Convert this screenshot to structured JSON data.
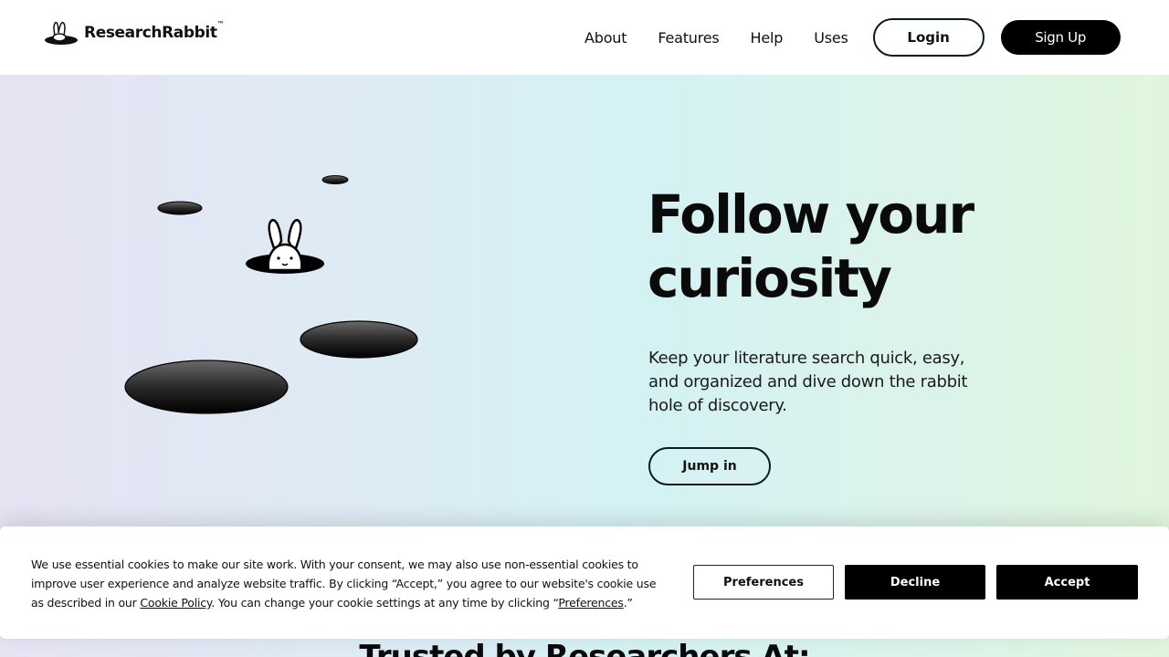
{
  "header": {
    "brand": "ResearchRabbit",
    "brand_tm": "™",
    "nav": [
      "About",
      "Features",
      "Help",
      "Uses"
    ],
    "login_label": "Login",
    "signup_label": "Sign Up"
  },
  "hero": {
    "headline_line1": "Follow your",
    "headline_line2": "curiosity",
    "subtext": "Keep your literature search quick, easy, and organized and dive down the rabbit hole of discovery.",
    "cta_label": "Jump in"
  },
  "trusted_heading": "Trusted by Researchers At:",
  "cookie": {
    "text_part1": "We use essential cookies to make our site work. With your consent, we may also use non-essential cookies to improve user experience and analyze website traffic. By clicking “Accept,” you agree to our website's cookie use as described in our ",
    "cookie_policy_link": "Cookie Policy",
    "text_part2": ". You can change your cookie settings at any time by clicking “",
    "preferences_link": "Preferences",
    "text_part3": ".”",
    "preferences_button": "Preferences",
    "decline_button": "Decline",
    "accept_button": "Accept"
  },
  "colors": {
    "primary": "#000000",
    "outline": "#0b1a2b",
    "gradient_left": "#e6e3f3",
    "gradient_mid": "#d4f2f4",
    "gradient_right": "#e0f6dc"
  },
  "icons": [
    "rabbit-logo-icon",
    "rabbit-in-hole-illustration"
  ]
}
